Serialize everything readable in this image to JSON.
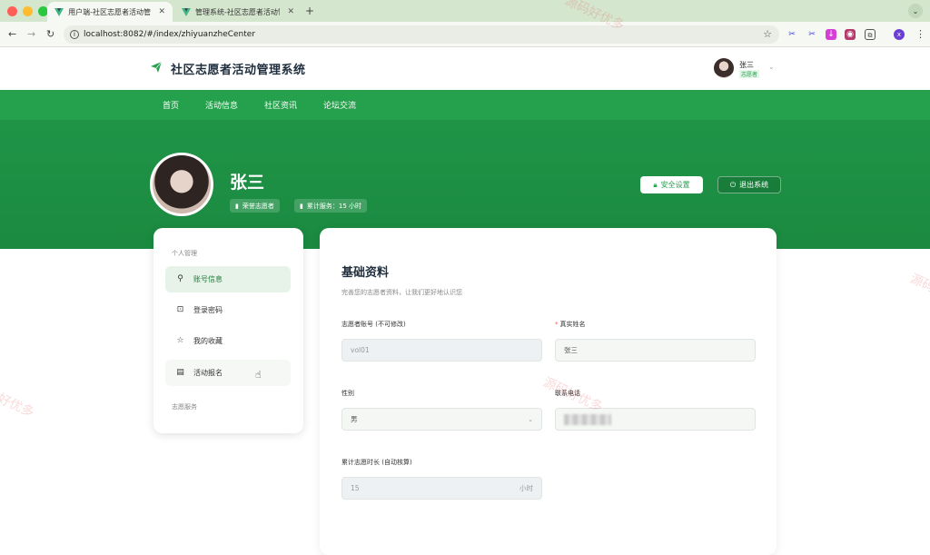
{
  "browser": {
    "tabs": [
      {
        "title": "用户端-社区志愿者活动管理系统"
      },
      {
        "title": "管理系统-社区志愿者活动管理系统"
      }
    ],
    "url": "localhost:8082/#/index/zhiyuanzheCenter"
  },
  "header": {
    "site_title": "社区志愿者活动管理系统",
    "user_name": "张三",
    "user_role": "志愿者"
  },
  "nav": {
    "items": [
      "首页",
      "活动信息",
      "社区资讯",
      "论坛交流"
    ]
  },
  "hero": {
    "name": "张三",
    "badge_honor": "荣誉志愿者",
    "badge_service": "累计服务：15 小时",
    "security_button": "安全设置",
    "logout_button": "退出系统"
  },
  "sidebar": {
    "section1": "个人管理",
    "items": [
      "账号信息",
      "登录密码",
      "我的收藏",
      "活动报名"
    ],
    "section2": "志愿服务"
  },
  "form": {
    "title": "基础资料",
    "subtitle": "完善您的志愿者资料，让我们更好地认识您",
    "account_label": "志愿者账号 (不可修改)",
    "account_value": "vol01",
    "realname_label": "真实姓名",
    "realname_value": "张三",
    "gender_label": "性别",
    "gender_value": "男",
    "phone_label": "联系电话",
    "hours_label": "累计志愿时长 (自动核算)",
    "hours_value": "15",
    "hours_unit": "小时"
  },
  "watermark": "源码好优多",
  "colors": {
    "brand_green": "#25a04c",
    "hero_green": "#1f9447"
  }
}
